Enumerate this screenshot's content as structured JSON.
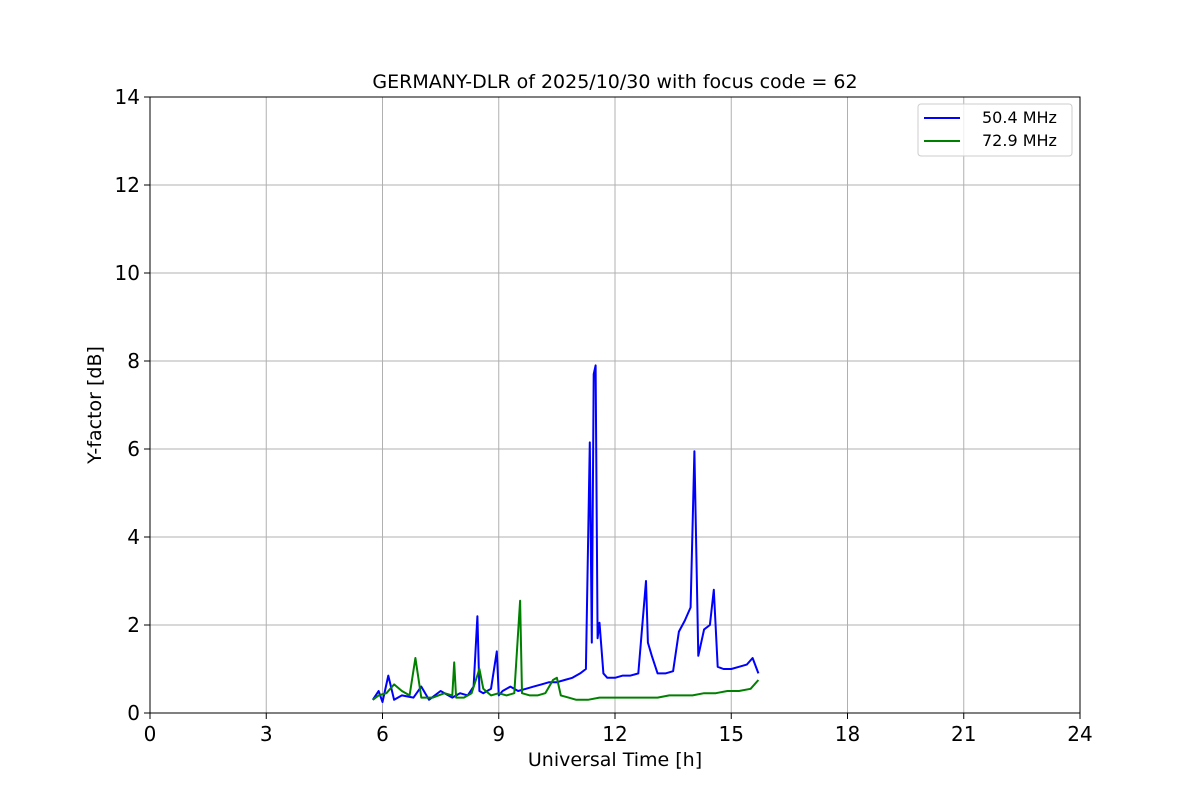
{
  "chart_data": {
    "type": "line",
    "title": "GERMANY-DLR of 2025/10/30 with focus code = 62",
    "xlabel": "Universal Time [h]",
    "ylabel": "Y-factor [dB]",
    "xlim": [
      0,
      24
    ],
    "ylim": [
      0,
      14
    ],
    "xticks": [
      "0",
      "3",
      "6",
      "9",
      "12",
      "15",
      "18",
      "21",
      "24"
    ],
    "yticks": [
      "0",
      "2",
      "4",
      "6",
      "8",
      "10",
      "12",
      "14"
    ],
    "grid": true,
    "legend_position": "top-right",
    "series": [
      {
        "name": "50.4 MHz",
        "color": "#0000ff",
        "x": [
          5.75,
          5.9,
          6.0,
          6.15,
          6.3,
          6.5,
          6.8,
          7.0,
          7.2,
          7.5,
          7.8,
          8.0,
          8.2,
          8.35,
          8.45,
          8.5,
          8.6,
          8.8,
          8.95,
          9.0,
          9.1,
          9.3,
          9.5,
          9.7,
          9.9,
          10.1,
          10.3,
          10.5,
          10.7,
          10.9,
          11.1,
          11.25,
          11.35,
          11.4,
          11.45,
          11.5,
          11.55,
          11.6,
          11.7,
          11.8,
          12.0,
          12.2,
          12.4,
          12.6,
          12.8,
          12.85,
          12.95,
          13.1,
          13.3,
          13.5,
          13.65,
          13.8,
          13.95,
          14.05,
          14.15,
          14.3,
          14.45,
          14.55,
          14.65,
          14.8,
          15.0,
          15.2,
          15.4,
          15.55,
          15.7
        ],
        "y": [
          0.3,
          0.5,
          0.25,
          0.85,
          0.3,
          0.4,
          0.35,
          0.6,
          0.3,
          0.5,
          0.35,
          0.45,
          0.4,
          0.6,
          2.2,
          0.5,
          0.45,
          0.55,
          1.4,
          0.4,
          0.5,
          0.6,
          0.5,
          0.55,
          0.6,
          0.65,
          0.7,
          0.7,
          0.75,
          0.8,
          0.9,
          1.0,
          6.15,
          1.6,
          7.7,
          7.9,
          1.7,
          2.05,
          0.9,
          0.8,
          0.8,
          0.85,
          0.85,
          0.9,
          3.0,
          1.6,
          1.3,
          0.9,
          0.9,
          0.95,
          1.85,
          2.1,
          2.4,
          5.95,
          1.3,
          1.9,
          2.0,
          2.8,
          1.05,
          1.0,
          1.0,
          1.05,
          1.1,
          1.25,
          0.9
        ]
      },
      {
        "name": "72.9 MHz",
        "color": "#008000",
        "x": [
          5.75,
          5.9,
          6.1,
          6.3,
          6.5,
          6.7,
          6.85,
          7.0,
          7.3,
          7.6,
          7.8,
          7.85,
          7.9,
          8.1,
          8.3,
          8.5,
          8.6,
          8.8,
          9.0,
          9.2,
          9.4,
          9.55,
          9.6,
          9.8,
          10.0,
          10.2,
          10.4,
          10.5,
          10.6,
          10.8,
          11.0,
          11.3,
          11.6,
          11.9,
          12.2,
          12.5,
          12.8,
          13.1,
          13.4,
          13.7,
          14.0,
          14.3,
          14.6,
          14.9,
          15.2,
          15.5,
          15.7
        ],
        "y": [
          0.3,
          0.4,
          0.45,
          0.65,
          0.5,
          0.4,
          1.25,
          0.35,
          0.35,
          0.45,
          0.4,
          1.15,
          0.35,
          0.35,
          0.45,
          1.0,
          0.55,
          0.4,
          0.45,
          0.4,
          0.45,
          2.55,
          0.45,
          0.4,
          0.4,
          0.45,
          0.75,
          0.8,
          0.4,
          0.35,
          0.3,
          0.3,
          0.35,
          0.35,
          0.35,
          0.35,
          0.35,
          0.35,
          0.4,
          0.4,
          0.4,
          0.45,
          0.45,
          0.5,
          0.5,
          0.55,
          0.75
        ]
      }
    ]
  }
}
